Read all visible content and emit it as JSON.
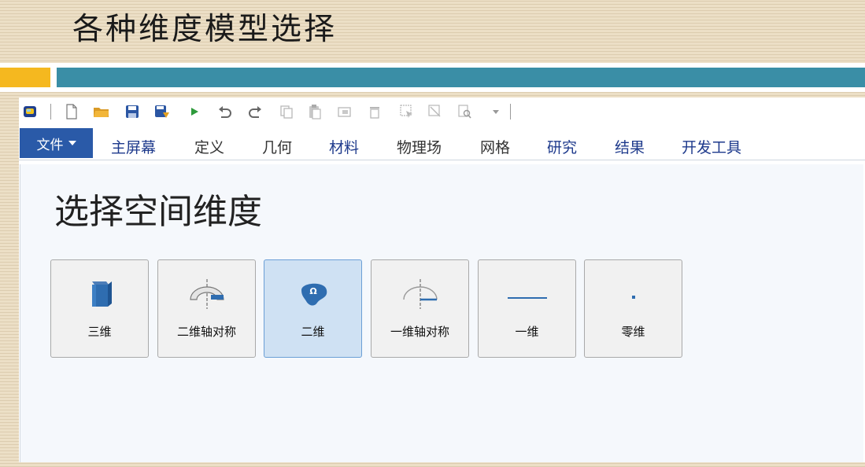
{
  "slide": {
    "title": "各种维度模型选择"
  },
  "toolbar": {
    "icons": [
      "app-logo-icon",
      "new-file-icon",
      "open-folder-icon",
      "save-icon",
      "save-as-icon",
      "run-icon",
      "undo-icon",
      "redo-icon",
      "copy-icon",
      "paste-icon",
      "duplicate-icon",
      "delete-icon",
      "select-all-icon",
      "clear-selection-icon",
      "find-icon",
      "dropdown-arrow-icon"
    ]
  },
  "menubar": {
    "file_label": "文件",
    "items": [
      {
        "label": "主屏幕"
      },
      {
        "label": "定义"
      },
      {
        "label": "几何"
      },
      {
        "label": "材料"
      },
      {
        "label": "物理场"
      },
      {
        "label": "网格"
      },
      {
        "label": "研究"
      },
      {
        "label": "结果"
      },
      {
        "label": "开发工具"
      }
    ]
  },
  "main": {
    "title": "选择空间维度",
    "dimensions": [
      {
        "label": "三维",
        "icon": "cube-icon",
        "selected": false
      },
      {
        "label": "二维轴对称",
        "icon": "2d-axisymmetric-icon",
        "selected": false
      },
      {
        "label": "二维",
        "icon": "2d-domain-icon",
        "selected": true
      },
      {
        "label": "一维轴对称",
        "icon": "1d-axisymmetric-icon",
        "selected": false
      },
      {
        "label": "一维",
        "icon": "line-icon",
        "selected": false
      },
      {
        "label": "零维",
        "icon": "point-icon",
        "selected": false
      }
    ]
  },
  "colors": {
    "accent_orange": "#f5b81f",
    "accent_teal": "#3a8ea6",
    "file_button": "#2a5aa8",
    "menu_text": "#1e3a8c",
    "selected_bg": "#cfe1f3"
  }
}
